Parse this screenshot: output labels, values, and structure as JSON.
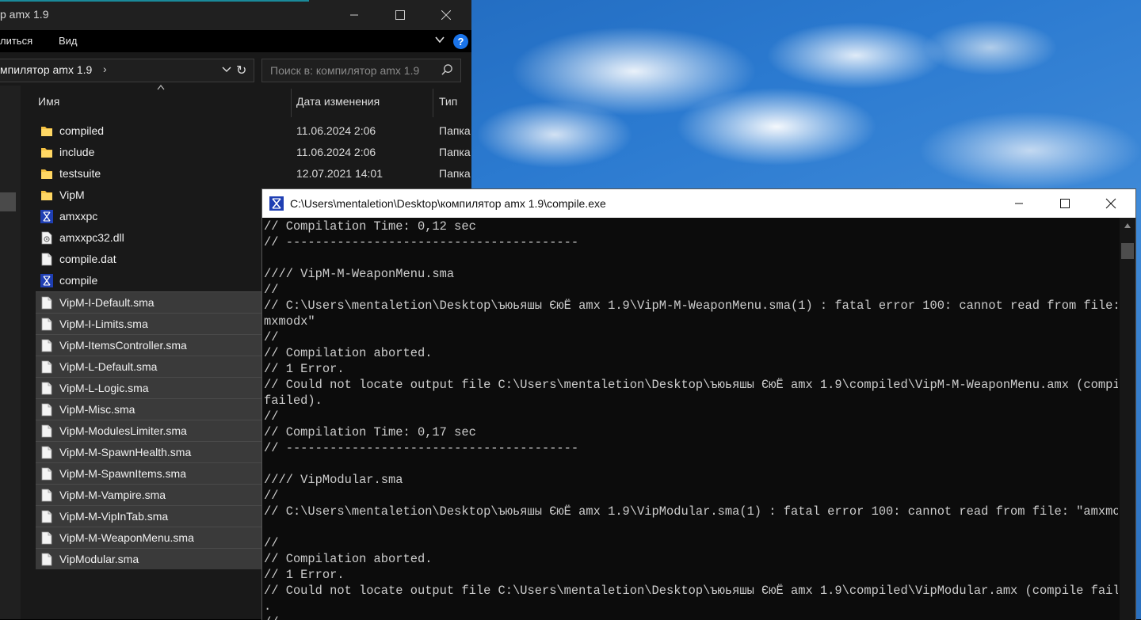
{
  "explorer": {
    "title": "р amx 1.9",
    "menu": {
      "share": "литься",
      "view": "Вид"
    },
    "address": {
      "path": "мпилятор amx 1.9"
    },
    "search": {
      "placeholder": "Поиск в: компилятор amx 1.9"
    },
    "columns": {
      "name": "Имя",
      "date": "Дата изменения",
      "type": "Тип"
    },
    "files": [
      {
        "name": "compiled",
        "icon": "folder-icon",
        "date": "11.06.2024 2:06",
        "type": "Папка"
      },
      {
        "name": "include",
        "icon": "folder-icon",
        "date": "11.06.2024 2:06",
        "type": "Папка"
      },
      {
        "name": "testsuite",
        "icon": "folder-icon",
        "date": "12.07.2021 14:01",
        "type": "Папка"
      },
      {
        "name": "VipM",
        "icon": "folder-icon",
        "date": "",
        "type": ""
      },
      {
        "name": "amxxpc",
        "icon": "exe-icon",
        "date": "",
        "type": ""
      },
      {
        "name": "amxxpc32.dll",
        "icon": "dll-icon",
        "date": "",
        "type": ""
      },
      {
        "name": "compile.dat",
        "icon": "file-icon",
        "date": "",
        "type": ""
      },
      {
        "name": "compile",
        "icon": "exe-icon",
        "date": "",
        "type": ""
      },
      {
        "name": "VipM-I-Default.sma",
        "icon": "file-icon",
        "date": "",
        "type": ""
      },
      {
        "name": "VipM-I-Limits.sma",
        "icon": "file-icon",
        "date": "",
        "type": ""
      },
      {
        "name": "VipM-ItemsController.sma",
        "icon": "file-icon",
        "date": "",
        "type": ""
      },
      {
        "name": "VipM-L-Default.sma",
        "icon": "file-icon",
        "date": "",
        "type": ""
      },
      {
        "name": "VipM-L-Logic.sma",
        "icon": "file-icon",
        "date": "",
        "type": ""
      },
      {
        "name": "VipM-Misc.sma",
        "icon": "file-icon",
        "date": "",
        "type": ""
      },
      {
        "name": "VipM-ModulesLimiter.sma",
        "icon": "file-icon",
        "date": "",
        "type": ""
      },
      {
        "name": "VipM-M-SpawnHealth.sma",
        "icon": "file-icon",
        "date": "",
        "type": ""
      },
      {
        "name": "VipM-M-SpawnItems.sma",
        "icon": "file-icon",
        "date": "",
        "type": ""
      },
      {
        "name": "VipM-M-Vampire.sma",
        "icon": "file-icon",
        "date": "",
        "type": ""
      },
      {
        "name": "VipM-M-VipInTab.sma",
        "icon": "file-icon",
        "date": "",
        "type": ""
      },
      {
        "name": "VipM-M-WeaponMenu.sma",
        "icon": "file-icon",
        "date": "",
        "type": ""
      },
      {
        "name": "VipModular.sma",
        "icon": "file-icon",
        "date": "",
        "type": ""
      }
    ]
  },
  "console": {
    "title": "C:\\Users\\mentaletion\\Desktop\\компилятор amx 1.9\\compile.exe",
    "lines": [
      "// Compilation Time: 0,12 sec",
      "// ----------------------------------------",
      "",
      "//// VipM-M-WeaponMenu.sma",
      "//",
      "// C:\\Users\\mentaletion\\Desktop\\ъюьяшы ЄюЁ amx 1.9\\VipM-M-WeaponMenu.sma(1) : fatal error 100: cannot read from file: \"a",
      "mxmodx\"",
      "//",
      "// Compilation aborted.",
      "// 1 Error.",
      "// Could not locate output file C:\\Users\\mentaletion\\Desktop\\ъюьяшы ЄюЁ amx 1.9\\compiled\\VipM-M-WeaponMenu.amx (compile",
      "failed).",
      "//",
      "// Compilation Time: 0,17 sec",
      "// ----------------------------------------",
      "",
      "//// VipModular.sma",
      "//",
      "// C:\\Users\\mentaletion\\Desktop\\ъюьяшы ЄюЁ amx 1.9\\VipModular.sma(1) : fatal error 100: cannot read from file: \"amxmodx\"",
      "",
      "//",
      "// Compilation aborted.",
      "// 1 Error.",
      "// Could not locate output file C:\\Users\\mentaletion\\Desktop\\ъюьяшы ЄюЁ amx 1.9\\compiled\\VipModular.amx (compile failed)",
      ".",
      "//"
    ]
  },
  "colors": {
    "accent": "#1a73e8",
    "console_bg": "#0c0c0c",
    "console_text": "#cccccc",
    "explorer_bg": "#191919",
    "folder": "#f5c242"
  }
}
